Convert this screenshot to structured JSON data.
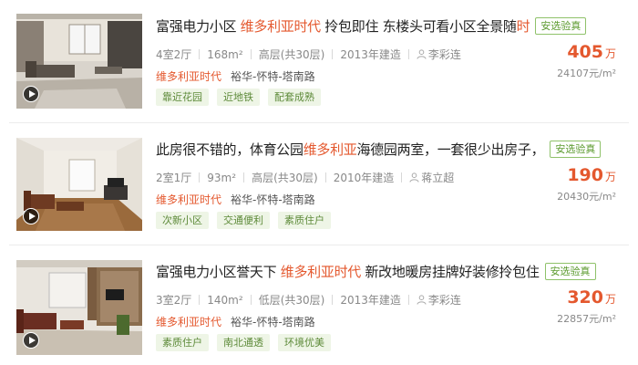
{
  "listings": [
    {
      "title_before": "富强电力小区 ",
      "title_highlight": "维多利亚时代",
      "title_after": " 拎包即住 东楼头可看小区全景随",
      "title_tail_highlight": "时",
      "badge": "安选验真",
      "layout": "4室2厅",
      "area": "168m²",
      "floor": "高层(共30层)",
      "built": "2013年建造",
      "agent": "李彩连",
      "community": "维多利亚时代",
      "district": "裕华-怀特-塔南路",
      "tags": [
        "靠近花园",
        "近地铁",
        "配套成熟"
      ],
      "price": "405",
      "price_unit": "万",
      "unit_price": "24107元/m²"
    },
    {
      "title_before": "此房很不错的，体育公园",
      "title_highlight": "维多利亚",
      "title_after": "海德园两室，一套很少出房子，",
      "title_tail_highlight": "",
      "badge": "安选验真",
      "layout": "2室1厅",
      "area": "93m²",
      "floor": "高层(共30层)",
      "built": "2010年建造",
      "agent": "蒋立超",
      "community": "维多利亚时代",
      "district": "裕华-怀特-塔南路",
      "tags": [
        "次新小区",
        "交通便利",
        "素质住户"
      ],
      "price": "190",
      "price_unit": "万",
      "unit_price": "20430元/m²"
    },
    {
      "title_before": "富强电力小区誉天下 ",
      "title_highlight": "维多利亚时代",
      "title_after": " 新改地暖房挂牌好装修拎包住",
      "title_tail_highlight": "",
      "badge": "安选验真",
      "layout": "3室2厅",
      "area": "140m²",
      "floor": "低层(共30层)",
      "built": "2013年建造",
      "agent": "李彩连",
      "community": "维多利亚时代",
      "district": "裕华-怀特-塔南路",
      "tags": [
        "素质住户",
        "南北通透",
        "环境优美"
      ],
      "price": "320",
      "price_unit": "万",
      "unit_price": "22857元/m²"
    }
  ],
  "icons": {
    "play": "play-icon",
    "agent": "person-icon"
  },
  "colors": {
    "accent": "#e4582e",
    "badge": "#5b9a2e",
    "tag_bg": "#eef5e6",
    "tag_text": "#5d8a39"
  }
}
